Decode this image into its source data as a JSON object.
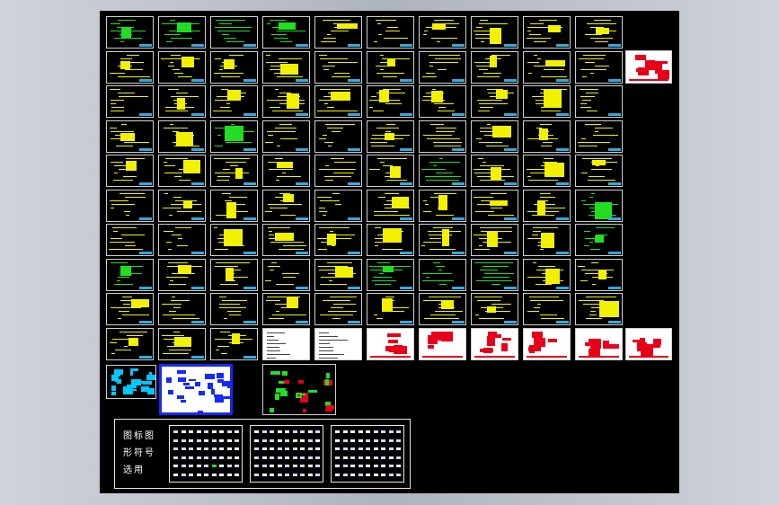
{
  "viewport": {
    "background_color": "#000000",
    "grid": {
      "cols": 10,
      "rows": 10
    }
  },
  "palette": {
    "text_yellow": "#f2f200",
    "text_green": "#22dd22",
    "frame_white": "#d8d8d8",
    "red": "#e8001a",
    "cyan": "#00c8ff",
    "blue": "#1428ff"
  },
  "sheets": {
    "row_kinds": [
      [
        "green",
        "green",
        "green",
        "green",
        "yellow",
        "yellow",
        "yellow",
        "yellow",
        "yellow",
        "yellow"
      ],
      [
        "yellow",
        "yellow",
        "yellow",
        "yellow",
        "yellow",
        "yellow",
        "yellow",
        "yellow",
        "yellow",
        "yellow"
      ],
      [
        "yellow",
        "yellow",
        "yellow",
        "yellow",
        "yellow",
        "yellow",
        "yellow",
        "yellow",
        "yellow",
        "yellow"
      ],
      [
        "yellow",
        "yellow",
        "green",
        "yellow",
        "yellow",
        "yellow",
        "yellow",
        "yellow",
        "yellow",
        "yellow"
      ],
      [
        "yellow",
        "yellow",
        "yellow",
        "yellow",
        "yellow",
        "yellow",
        "green",
        "yellow",
        "yellow",
        "yellow"
      ],
      [
        "yellow",
        "yellow",
        "yellow",
        "yellow",
        "yellow",
        "yellow",
        "yellow",
        "yellow",
        "yellow",
        "green"
      ],
      [
        "yellow",
        "yellow",
        "yellow",
        "yellow",
        "yellow",
        "yellow",
        "yellow",
        "yellow",
        "yellow",
        "green"
      ],
      [
        "green",
        "yellow",
        "yellow",
        "yellow",
        "yellow",
        "green",
        "green",
        "green",
        "yellow",
        "yellow"
      ],
      [
        "yellow",
        "yellow",
        "yellow",
        "yellow",
        "yellow",
        "yellow",
        "yellow",
        "yellow",
        "yellow",
        "yellow"
      ],
      [
        "yellow",
        "yellow",
        "yellow",
        "white",
        "white",
        "red",
        "red",
        "red",
        "red",
        "red"
      ]
    ],
    "extra_sheets": [
      "small-table-sheet",
      "red-table-sheet"
    ]
  },
  "special_sheets": [
    {
      "kind": "cyan-schematic"
    },
    {
      "kind": "blue-symbol-sheet"
    },
    {
      "kind": "red-green-grid"
    }
  ],
  "legend": {
    "title_text": "图标图形符号选用"
  },
  "legend_sheets": [
    {
      "kind": "symbols-a"
    },
    {
      "kind": "symbols-b"
    },
    {
      "kind": "symbols-c"
    }
  ]
}
